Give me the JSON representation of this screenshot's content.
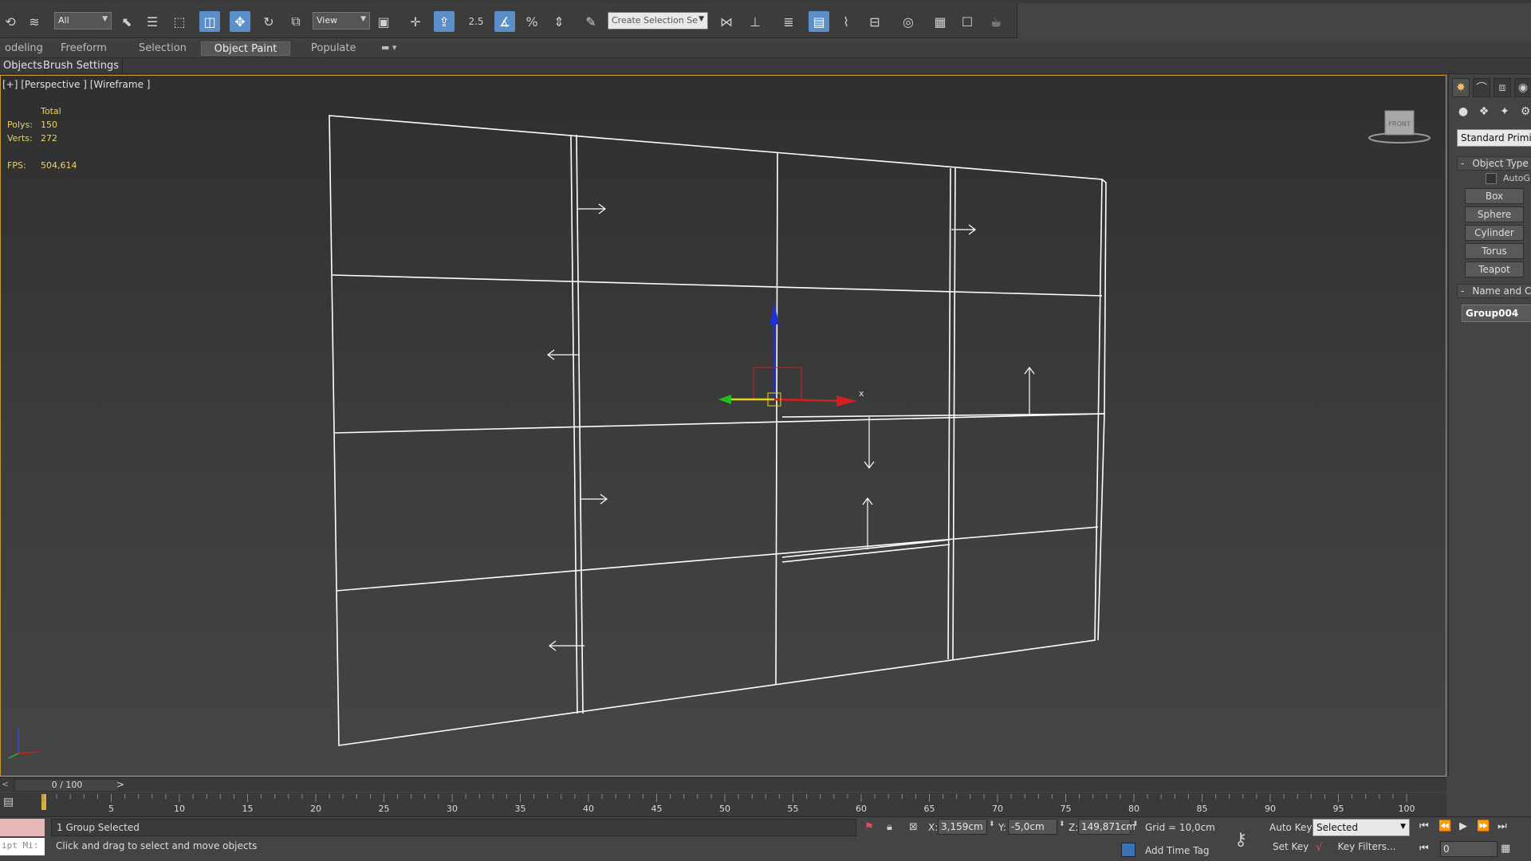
{
  "toolbar": {
    "selection_filter": "All",
    "ref_coord": "View",
    "snap_label": "2.5",
    "named_selection_placeholder": "Create Selection Se"
  },
  "ribbon": {
    "tabs": [
      "odeling",
      "Freeform",
      "Selection",
      "Object Paint",
      "Populate"
    ],
    "active_tab": "Object Paint",
    "subtabs": [
      "Objects",
      "Brush Settings"
    ]
  },
  "viewport": {
    "label": "[+] [Perspective ] [Wireframe ]",
    "stats": {
      "total_label": "Total",
      "polys_label": "Polys:",
      "polys_value": "150",
      "verts_label": "Verts:",
      "verts_value": "272",
      "fps_label": "FPS:",
      "fps_value": "504,614"
    },
    "gizmo_x_label": "x",
    "viewcube_label": "FRONT"
  },
  "command_panel": {
    "primitive_type": "Standard Primitives",
    "object_type_header": "Object Type",
    "autogrid_label": "AutoGrid",
    "buttons": [
      "Box",
      "Sphere",
      "Cylinder",
      "Torus",
      "Teapot"
    ],
    "name_color_header": "Name and Color",
    "object_name": "Group004"
  },
  "timeline": {
    "slider_text": "0 / 100",
    "ticks": [
      "5",
      "10",
      "15",
      "20",
      "25",
      "30",
      "35",
      "40",
      "45",
      "50",
      "55",
      "60",
      "65",
      "70",
      "75",
      "80",
      "85",
      "90",
      "95",
      "100"
    ]
  },
  "status": {
    "maxscript_text": "ipt Mi:",
    "selection_info": "1 Group Selected",
    "prompt": "Click and drag to select and move objects",
    "x_label": "X:",
    "x_value": "3,159cm",
    "y_label": "Y:",
    "y_value": "-5,0cm",
    "z_label": "Z:",
    "z_value": "149,871cm",
    "grid": "Grid = 10,0cm",
    "add_time_tag": "Add Time Tag",
    "auto_key": "Auto Key",
    "set_key": "Set Key",
    "key_mode": "Selected",
    "key_filters": "Key Filters...",
    "current_frame": "0"
  },
  "colors": {
    "accent": "#5a8fc9",
    "viewport_border": "#c89a2e",
    "stats_text": "#e8d36a",
    "gizmo_x": "#d02020",
    "gizmo_y": "#20c020",
    "gizmo_z": "#2030d0"
  }
}
